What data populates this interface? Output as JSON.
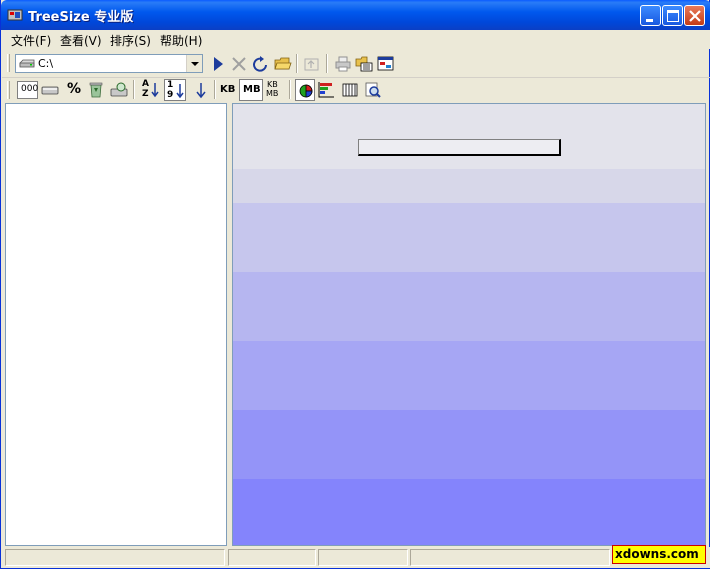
{
  "window": {
    "title": "TreeSize 专业版"
  },
  "menu": {
    "items": [
      {
        "label": "文件(F)"
      },
      {
        "label": "查看(V)"
      },
      {
        "label": "排序(S)"
      },
      {
        "label": "帮助(H)"
      }
    ]
  },
  "toolbar1": {
    "drive_value": "C:\\",
    "icons": [
      "play-icon",
      "stop-icon",
      "refresh-icon",
      "open-folder-icon",
      "up-folder-icon",
      "print-icon",
      "export-icon",
      "options-icon"
    ]
  },
  "toolbar2": {
    "count_label": "000",
    "percent_label": "%",
    "unit_kb": "KB",
    "unit_mb": "MB",
    "unit_kbmb_top": "KB",
    "unit_kbmb_bottom": "MB",
    "sort_az_top": "A",
    "sort_az_bottom": "Z",
    "sort_19_top": "1",
    "sort_19_bottom": "9"
  },
  "chart_panel": {
    "band_colors": [
      "#e3e3eb",
      "#d7d7e9",
      "#c6c6ed",
      "#b6b6f0",
      "#a6a6f4",
      "#9494f8",
      "#8484fc"
    ]
  },
  "watermark": {
    "text": "xdowns.com"
  }
}
